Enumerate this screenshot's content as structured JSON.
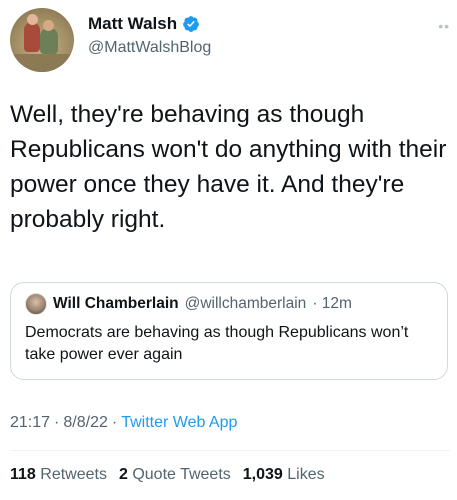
{
  "author": {
    "name": "Matt Walsh",
    "handle": "@MattWalshBlog"
  },
  "more_icon": "more-dots-icon",
  "tweet": {
    "text": "Well, they're behaving as though Republicans won't do anything with their power once they have it. And they're probably right."
  },
  "quoted": {
    "name": "Will Chamberlain",
    "handle": "@willchamberlain",
    "time": "· 12m",
    "text": "Democrats are behaving as though Republicans won’t take power ever again"
  },
  "meta": {
    "time": "21:17",
    "sep1": "·",
    "date": "8/8/22",
    "sep2": "·",
    "app": "Twitter Web App"
  },
  "stats": {
    "retweets_count": "118",
    "retweets_label": "Retweets",
    "quotes_count": "2",
    "quotes_label": "Quote Tweets",
    "likes_count": "1,039",
    "likes_label": "Likes"
  },
  "colors": {
    "accent": "#1d9bf0",
    "secondary_text": "#536471",
    "border": "#cfd9de"
  }
}
